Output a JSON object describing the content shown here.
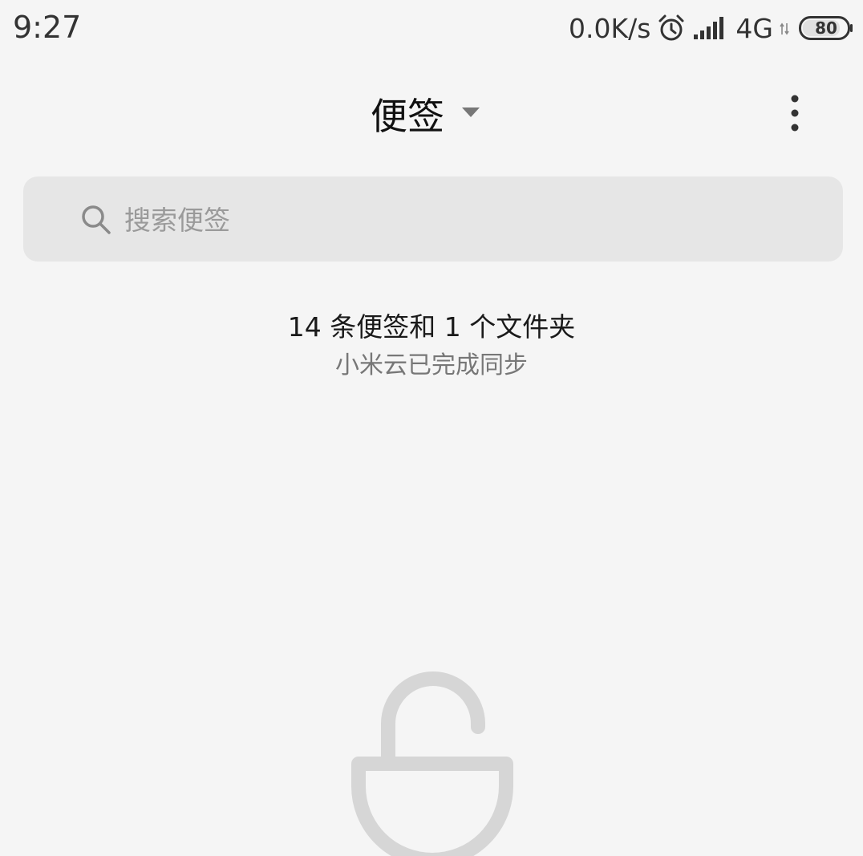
{
  "status_bar": {
    "time": "9:27",
    "net_speed": "0.0K/s",
    "network_type": "4G",
    "battery_level": "80",
    "icons": {
      "alarm": "alarm-clock-icon",
      "signal": "cell-signal-icon",
      "data": "data-arrows-icon",
      "battery": "battery-icon"
    }
  },
  "header": {
    "title": "便签",
    "dropdown_icon": "caret-down-icon",
    "more_icon": "more-vertical-icon"
  },
  "search": {
    "placeholder": "搜索便签",
    "value": "",
    "icon": "search-icon"
  },
  "summary": {
    "count_text": "14 条便签和 1 个文件夹",
    "sync_text": "小米云已完成同步"
  },
  "illustration": {
    "icon": "unlocked-padlock-icon"
  },
  "colors": {
    "background": "#f5f5f5",
    "search_background": "#e6e6e6",
    "title_text": "#111111",
    "secondary_text": "#777777",
    "placeholder_text": "#9a9a9a",
    "illustration": "#d6d6d6"
  }
}
